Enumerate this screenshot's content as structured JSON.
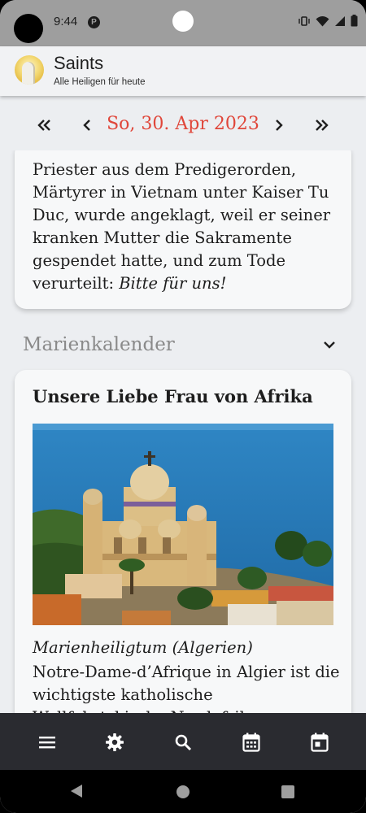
{
  "status_bar": {
    "time": "9:44",
    "p_badge": "P"
  },
  "app_bar": {
    "title": "Saints",
    "subtitle": "Alle Heiligen für heute",
    "logo_icon": "saint-logo-icon"
  },
  "date_nav": {
    "date": "So, 30. Apr 2023",
    "first_icon": "double-chevron-left-icon",
    "prev_icon": "chevron-left-icon",
    "next_icon": "chevron-right-icon",
    "last_icon": "double-chevron-right-icon"
  },
  "saint_card": {
    "text": "Priester aus dem Predigerorden, Märtyrer in Vietnam unter Kaiser Tu Duc, wurde angeklagt, weil er seiner kranken Mutter die Sakramente gespendet hatte, und zum Tode verurteilt: ",
    "text_italic": "Bitte für uns!"
  },
  "marian_section": {
    "title": "Marienkalender",
    "toggle_icon": "chevron-down-icon"
  },
  "marian_card": {
    "title": "Unsere Liebe Frau von Afrika",
    "subtitle": "Marienheiligtum (Algerien)",
    "body": "Notre-Dame-d’Afrique in Algier ist die wichtigste katholische Wallfahrtskirche Nordafrikas"
  },
  "bottom_nav": [
    {
      "icon": "menu-icon"
    },
    {
      "icon": "gear-icon"
    },
    {
      "icon": "search-icon"
    },
    {
      "icon": "calendar-grid-icon"
    },
    {
      "icon": "calendar-today-icon"
    }
  ],
  "colors": {
    "accent": "#e0463a",
    "background": "#eceef1",
    "card": "#f7f8f9",
    "bottom_bar": "#2a2b30"
  }
}
